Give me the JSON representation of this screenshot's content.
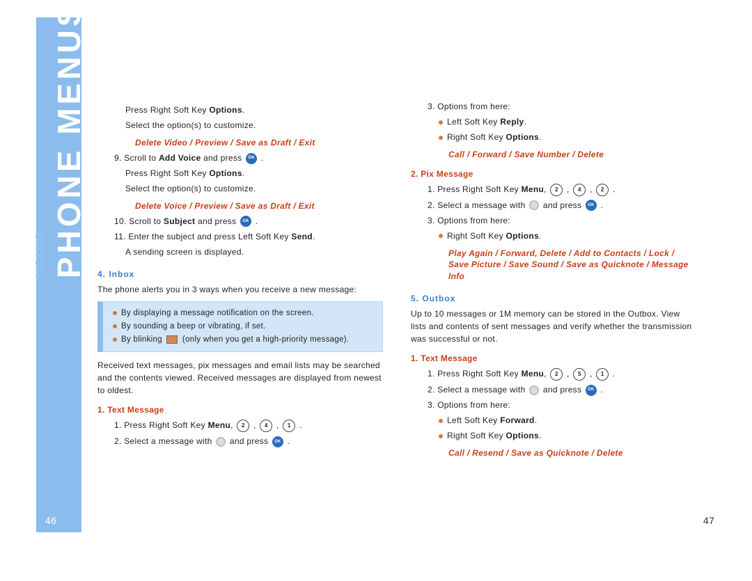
{
  "sidebar": {
    "small": "USING",
    "large": "PHONE MENUS"
  },
  "left": {
    "l1a": "Press Right Soft Key ",
    "l1b": "Options",
    "l1c": ".",
    "l2": "Select the option(s) to customize.",
    "red1": "Delete Video / Preview / Save as Draft / Exit",
    "l3a": "9. Scroll to ",
    "l3b": "Add Voice",
    "l3c": " and press ",
    "l4a": "Press Right Soft Key ",
    "l4b": "Options",
    "l4c": ".",
    "l5": "Select the option(s) to customize.",
    "red2": "Delete Voice / Preview / Save as Draft / Exit",
    "l6a": "10. Scroll to ",
    "l6b": "Subject",
    "l6c": " and press ",
    "l7a": "11. Enter the subject and press Left Soft Key ",
    "l7b": "Send",
    "l7c": ".",
    "l8": "A sending screen is displayed.",
    "head_inbox": "4. Inbox",
    "inbox_intro": "The phone alerts you in 3 ways when you receive a new message:",
    "alert1": "By displaying a message notification on the screen.",
    "alert2": "By sounding a beep or vibrating, if set.",
    "alert3a": "By blinking ",
    "alert3b": " (only when you get a high-priority message).",
    "inbox_para": "Received text messages, pix messages and email lists may be searched and the contents viewed. Received messages are displayed from newest to oldest.",
    "sub_text": "1. Text Message",
    "t1a": "1. Press Right Soft Key ",
    "t1b": "Menu",
    "t1c": ", ",
    "k241": [
      "2",
      "4",
      "1"
    ],
    "t2a": "2. Select a message with ",
    "t2b": " and press "
  },
  "right": {
    "r1": "3. Options from here:",
    "r2a": "Left Soft Key ",
    "r2b": "Reply",
    "r3a": "Right Soft Key ",
    "r3b": "Options",
    "red3": "Call / Forward / Save Number / Delete",
    "sub_pix": "2. Pix Message",
    "p1a": "1. Press Right Soft Key ",
    "p1b": "Menu",
    "p1c": ", ",
    "k242": [
      "2",
      "4",
      "2"
    ],
    "p2a": "2. Select a message with ",
    "p2b": " and press ",
    "p3": "3. Options from here:",
    "p4a": "Right Soft Key ",
    "p4b": "Options",
    "red4": "Play Again / Forward, Delete / Add to Contacts / Lock / Save Picture / Save Sound / Save as Quicknote / Message Info",
    "head_outbox": "5. Outbox",
    "outbox_para": "Up to 10 messages or 1M memory can be stored in the Outbox. View lists and contents of sent messages and verify whether the transmission was successful or not.",
    "sub_text2": "1. Text Message",
    "o1a": "1. Press Right Soft Key ",
    "o1b": "Menu",
    "o1c": ", ",
    "k251": [
      "2",
      "5",
      "1"
    ],
    "o2a": "2. Select a message with ",
    "o2b": " and press ",
    "o3": "3. Options from here:",
    "o4a": "Left Soft Key ",
    "o4b": "Forward",
    "o5a": "Right Soft Key ",
    "o5b": "Options",
    "red5": "Call / Resend / Save as Quicknote / Delete"
  },
  "pages": {
    "left": "46",
    "right": "47"
  }
}
